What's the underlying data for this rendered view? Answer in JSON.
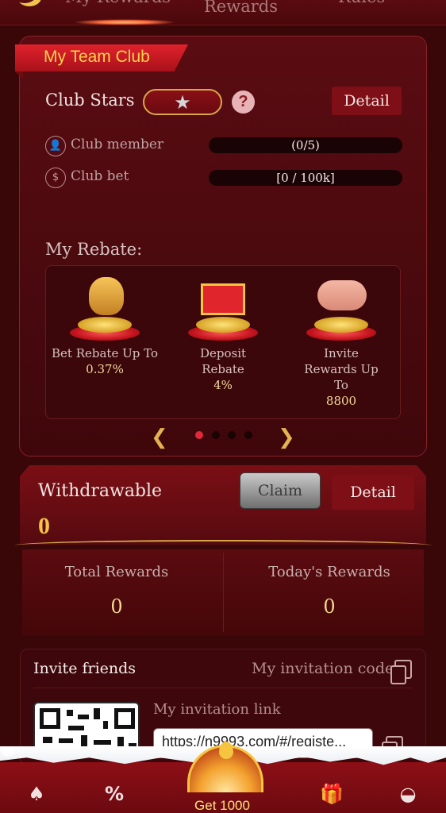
{
  "top_tabs": {
    "tab1": "My Rewards",
    "tab2": "Rewards",
    "tab3": "Rules"
  },
  "club": {
    "banner": "My Team Club",
    "stars_label": "Club Stars",
    "star_icon": "★",
    "help_icon": "?",
    "detail_label": "Detail",
    "member_label": "Club member",
    "member_progress": "(0/5)",
    "bet_label": "Club bet",
    "bet_progress": "[0 / 100k]"
  },
  "rebate": {
    "title": "My Rebate:",
    "items": [
      {
        "label": "Bet Rebate Up To",
        "value": "0.37%",
        "icon": "money-bag-icon"
      },
      {
        "label": "Deposit Rebate",
        "value": "4%",
        "icon": "gift-box-icon"
      },
      {
        "label": "Invite Rewards Up To",
        "value": "8800",
        "icon": "handshake-icon"
      }
    ],
    "prev_icon": "❮",
    "next_icon": "❯",
    "page_count": 4,
    "active_page": 1
  },
  "withdraw": {
    "label": "Withdrawable",
    "claim_label": "Claim",
    "detail_label": "Detail",
    "value": "0"
  },
  "rewards": {
    "total_label": "Total Rewards",
    "total_value": "0",
    "today_label": "Today's Rewards",
    "today_value": "0"
  },
  "invite": {
    "title": "Invite friends",
    "code_label": "My invitation code",
    "link_label": "My invitation link",
    "link_value": "https://n9993.com/#/registe..."
  },
  "bottom_nav": {
    "home_icon": "♠",
    "promo_icon": "%",
    "gift_icon": "🎁",
    "profile_icon": "◒",
    "promo_label": "Get 1000"
  },
  "colors": {
    "background": "#3a0709",
    "accent_gold": "#f3c449",
    "banner_red": "#e0222c"
  }
}
